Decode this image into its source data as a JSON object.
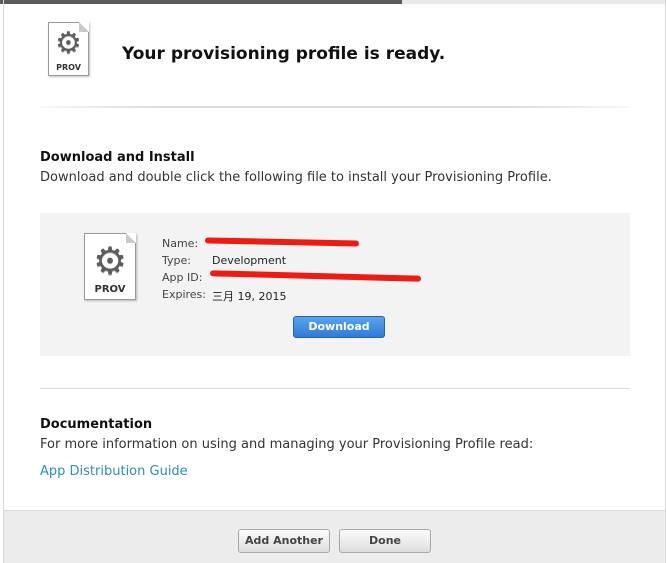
{
  "header": {
    "title": "Your provisioning profile is ready.",
    "icon_label": "PROV"
  },
  "download_section": {
    "heading": "Download and Install",
    "description": "Download and double click the following file to install your Provisioning Profile.",
    "profile": {
      "icon_label": "PROV",
      "name_label": "Name:",
      "type_label": "Type:",
      "type_value": "Development",
      "app_id_label": "App ID:",
      "expires_label": "Expires:",
      "expires_value": "三月 19, 2015"
    },
    "download_button": "Download"
  },
  "documentation_section": {
    "heading": "Documentation",
    "description": "For more information on using and managing your Provisioning Profile read:",
    "link": "App Distribution Guide"
  },
  "footer": {
    "add_another_button": "Add Another",
    "done_button": "Done"
  },
  "colors": {
    "link": "#2e8cc4",
    "primary_button": "#2f7bd7",
    "redaction": "#ee1b12"
  },
  "icons": {
    "profile_icon": "gear-document-icon"
  }
}
